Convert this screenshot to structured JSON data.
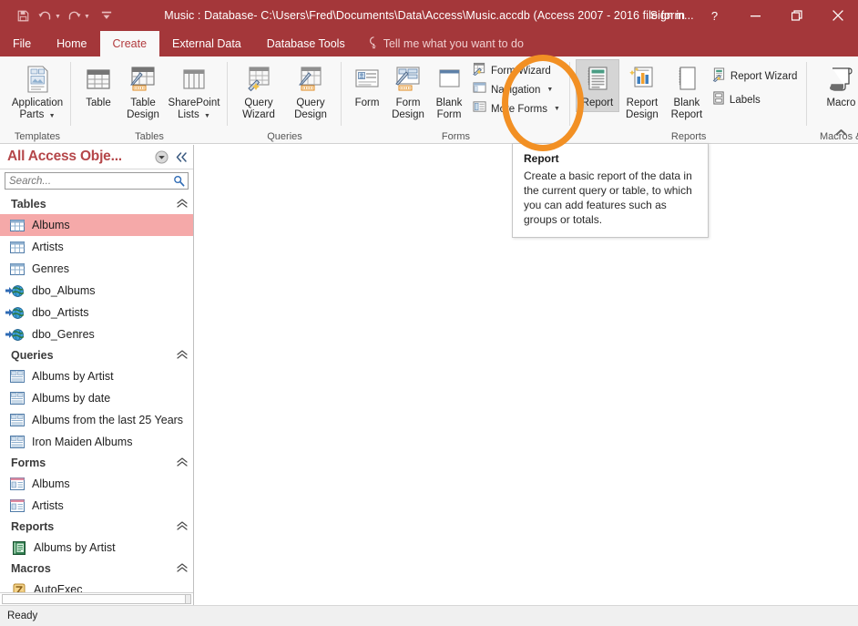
{
  "titlebar": {
    "title": "Music : Database- C:\\Users\\Fred\\Documents\\Data\\Access\\Music.accdb (Access 2007 - 2016 file form...",
    "signin": "Sign in",
    "qat": [
      {
        "name": "save-icon",
        "label": "Save"
      },
      {
        "name": "undo-icon",
        "label": "Undo"
      },
      {
        "name": "redo-icon",
        "label": "Redo"
      },
      {
        "name": "customize-quick-access-toolbar-icon",
        "label": "Customize Quick Access Toolbar"
      }
    ],
    "help": "?",
    "minimize": "Minimize",
    "restore": "Restore Down",
    "close": "Close"
  },
  "tabs": [
    {
      "label": "File",
      "active": false
    },
    {
      "label": "Home",
      "active": false
    },
    {
      "label": "Create",
      "active": true
    },
    {
      "label": "External Data",
      "active": false
    },
    {
      "label": "Database Tools",
      "active": false
    }
  ],
  "tellme": "Tell me what you want to do",
  "ribbon": {
    "collapse_label": "Collapse the Ribbon",
    "groups": [
      {
        "title": "Templates",
        "big": [
          {
            "label": "Application\nParts",
            "label1": "Application",
            "label2": "Parts",
            "dropdown": true,
            "icon": "application-parts-icon"
          }
        ],
        "small": []
      },
      {
        "title": "Tables",
        "big": [
          {
            "label1": "Table",
            "label2": "",
            "dropdown": false,
            "icon": "table-icon"
          },
          {
            "label1": "Table",
            "label2": "Design",
            "dropdown": false,
            "icon": "table-design-icon"
          },
          {
            "label1": "SharePoint",
            "label2": "Lists",
            "dropdown": true,
            "icon": "sharepoint-lists-icon"
          }
        ],
        "small": []
      },
      {
        "title": "Queries",
        "big": [
          {
            "label1": "Query",
            "label2": "Wizard",
            "dropdown": false,
            "icon": "query-wizard-icon"
          },
          {
            "label1": "Query",
            "label2": "Design",
            "dropdown": false,
            "icon": "query-design-icon"
          }
        ],
        "small": []
      },
      {
        "title": "Forms",
        "big": [
          {
            "label1": "Form",
            "label2": "",
            "dropdown": false,
            "icon": "form-icon"
          },
          {
            "label1": "Form",
            "label2": "Design",
            "dropdown": false,
            "icon": "form-design-icon"
          },
          {
            "label1": "Blank",
            "label2": "Form",
            "dropdown": false,
            "icon": "blank-form-icon"
          }
        ],
        "small": [
          {
            "label": "Form Wizard",
            "dropdown": false,
            "icon": "form-wizard-icon"
          },
          {
            "label": "Navigation",
            "dropdown": true,
            "icon": "navigation-icon"
          },
          {
            "label": "More Forms",
            "dropdown": true,
            "icon": "more-forms-icon"
          }
        ]
      },
      {
        "title": "Reports",
        "big": [
          {
            "label1": "Report",
            "label2": "",
            "dropdown": false,
            "icon": "report-icon",
            "hover": true
          },
          {
            "label1": "Report",
            "label2": "Design",
            "dropdown": false,
            "icon": "report-design-icon"
          },
          {
            "label1": "Blank",
            "label2": "Report",
            "dropdown": false,
            "icon": "blank-report-icon"
          }
        ],
        "small": [
          {
            "label": "Report Wizard",
            "dropdown": false,
            "icon": "report-wizard-icon"
          },
          {
            "label": "Labels",
            "dropdown": false,
            "icon": "labels-icon"
          }
        ]
      },
      {
        "title": "Macros & Code",
        "big": [
          {
            "label1": "Macro",
            "label2": "",
            "dropdown": false,
            "icon": "macro-icon"
          }
        ],
        "small": [],
        "mini": [
          "module-icon",
          "class-module-icon",
          "visual-basic-icon"
        ]
      }
    ]
  },
  "tooltip": {
    "title": "Report",
    "body": "Create a basic report of the data in the current query or table, to which you can add features such as groups or totals."
  },
  "navpane": {
    "title": "All Access Obje...",
    "menu_icon": "chevron-down-circle-icon",
    "shutter_icon": "shutter-bar-close-icon",
    "search_placeholder": "Search...",
    "search_value": "",
    "groups": [
      {
        "name": "Tables",
        "items": [
          {
            "label": "Albums",
            "icon": "table-object-icon",
            "selected": true
          },
          {
            "label": "Artists",
            "icon": "table-object-icon",
            "selected": false
          },
          {
            "label": "Genres",
            "icon": "table-object-icon",
            "selected": false
          },
          {
            "label": "dbo_Albums",
            "icon": "linked-table-globe-icon",
            "selected": false
          },
          {
            "label": "dbo_Artists",
            "icon": "linked-table-globe-icon",
            "selected": false
          },
          {
            "label": "dbo_Genres",
            "icon": "linked-table-globe-icon",
            "selected": false
          }
        ]
      },
      {
        "name": "Queries",
        "items": [
          {
            "label": "Albums by Artist",
            "icon": "query-object-icon",
            "selected": false
          },
          {
            "label": "Albums by date",
            "icon": "query-object-icon",
            "selected": false
          },
          {
            "label": "Albums from the last 25 Years",
            "icon": "query-object-icon",
            "selected": false
          },
          {
            "label": "Iron Maiden Albums",
            "icon": "query-object-icon",
            "selected": false
          }
        ]
      },
      {
        "name": "Forms",
        "items": [
          {
            "label": "Albums",
            "icon": "form-object-icon",
            "selected": false
          },
          {
            "label": "Artists",
            "icon": "form-object-icon",
            "selected": false
          }
        ]
      },
      {
        "name": "Reports",
        "items": [
          {
            "label": "Albums by Artist",
            "icon": "report-object-icon",
            "selected": false
          }
        ]
      },
      {
        "name": "Macros",
        "items": [
          {
            "label": "AutoExec",
            "icon": "macro-object-icon",
            "selected": false
          }
        ]
      }
    ]
  },
  "statusbar": {
    "text": "Ready"
  },
  "colors": {
    "accent": "#a4373a",
    "annotation": "#F29024",
    "selection": "#f5a9a9",
    "ribbon_bg": "#f8f8f8"
  }
}
